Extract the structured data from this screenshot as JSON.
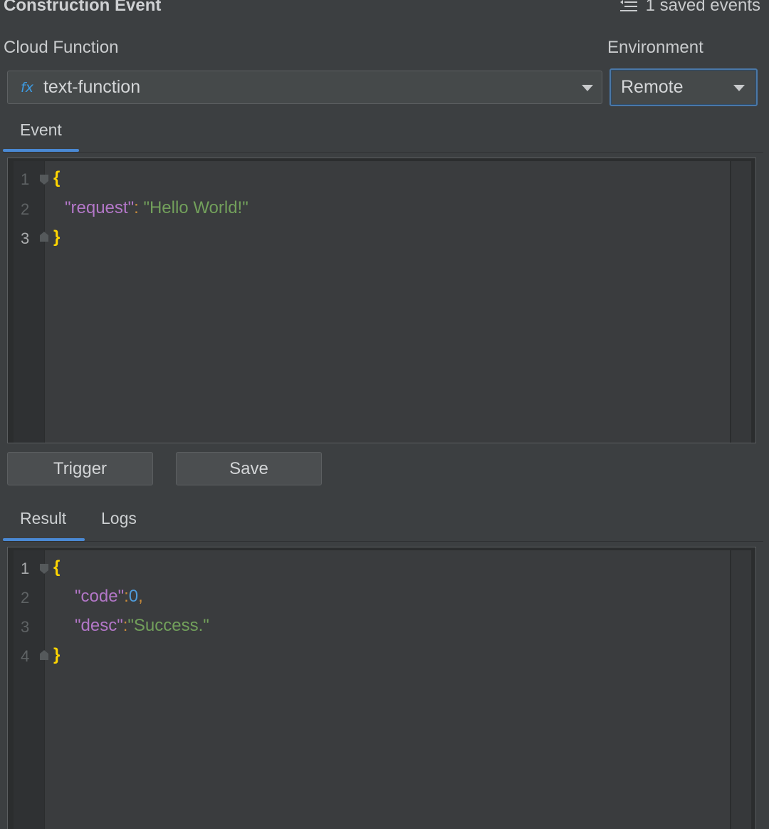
{
  "header": {
    "title": "Construction Event",
    "saved_events_label": "1 saved events"
  },
  "form": {
    "cloud_function_label": "Cloud Function",
    "environment_label": "Environment",
    "cloud_function_value": "text-function",
    "cloud_function_icon_text": "fx",
    "environment_value": "Remote"
  },
  "event_panel": {
    "tab_label": "Event",
    "line_numbers": [
      "1",
      "2",
      "3"
    ],
    "line2_key": "\"request\"",
    "line2_colon": ": ",
    "line2_value": "\"Hello World!\""
  },
  "buttons": {
    "trigger_label": "Trigger",
    "save_label": "Save"
  },
  "result_panel": {
    "tabs": [
      {
        "label": "Result"
      },
      {
        "label": "Logs"
      }
    ],
    "line_numbers": [
      "1",
      "2",
      "3",
      "4"
    ],
    "line2_key": "\"code\"",
    "line2_colon": ":",
    "line2_value": "0",
    "line2_comma": ",",
    "line3_key": "\"desc\"",
    "line3_colon": ":",
    "line3_value": "\"Success.\""
  },
  "code": {
    "open_brace": "{",
    "close_brace": "}"
  },
  "icons": {
    "saved": "list-outdent-icon",
    "dropdown": "chevron-down-icon",
    "fold": "fold-marker-icon"
  },
  "colors": {
    "accent": "#4a89d4",
    "key": "#b377c8",
    "string": "#72a05b",
    "number": "#4f9ad8",
    "brace": "#ffd600"
  }
}
